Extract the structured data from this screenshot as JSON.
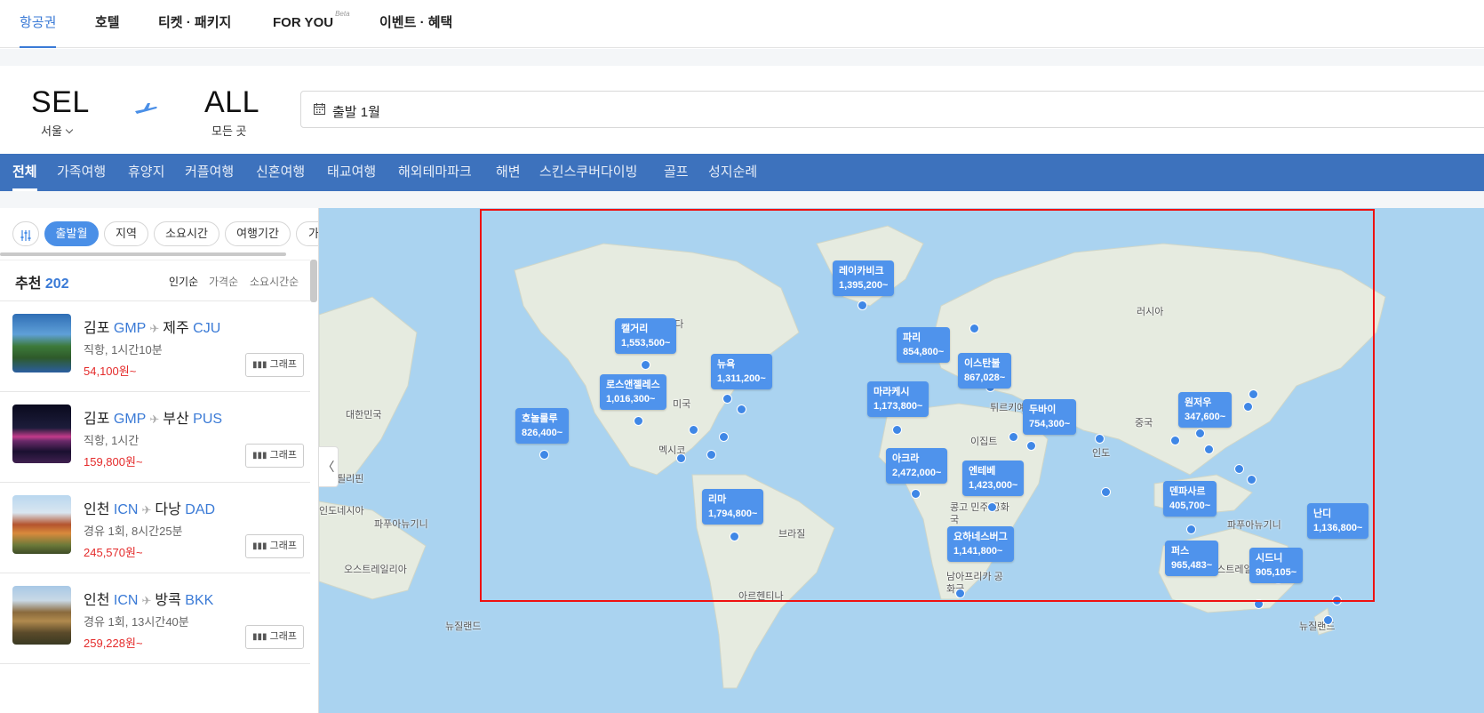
{
  "nav": {
    "tabs": [
      {
        "label": "항공권",
        "active": true
      },
      {
        "label": "호텔"
      },
      {
        "label": "티켓 · 패키지"
      },
      {
        "label": "FOR YOU",
        "badge": "Beta"
      },
      {
        "label": "이벤트 · 혜택"
      }
    ]
  },
  "search": {
    "origin_code": "SEL",
    "origin_city": "서울",
    "dest_code": "ALL",
    "dest_city": "모든 곳",
    "date_label": "출발 1월"
  },
  "themes": [
    "전체",
    "가족여행",
    "휴양지",
    "커플여행",
    "신혼여행",
    "태교여행",
    "해외테마파크",
    "해변",
    "스킨스쿠버다이빙",
    "골프",
    "성지순례"
  ],
  "filters": {
    "chips": [
      "출발월",
      "지역",
      "소요시간",
      "여행기간",
      "가"
    ],
    "active_chip": "출발월"
  },
  "recommend": {
    "title": "추천",
    "count": "202",
    "sorts": [
      "인기순",
      "가격순",
      "소요시간순"
    ],
    "active_sort": "인기순"
  },
  "items": [
    {
      "from": "김포",
      "from_code": "GMP",
      "to": "제주",
      "to_code": "CJU",
      "info": "직항, 1시간10분",
      "price": "54,100원~",
      "graph": "그래프"
    },
    {
      "from": "김포",
      "from_code": "GMP",
      "to": "부산",
      "to_code": "PUS",
      "info": "직항, 1시간",
      "price": "159,800원~",
      "graph": "그래프"
    },
    {
      "from": "인천",
      "from_code": "ICN",
      "to": "다낭",
      "to_code": "DAD",
      "info": "경유 1회, 8시간25분",
      "price": "245,570원~",
      "graph": "그래프"
    },
    {
      "from": "인천",
      "from_code": "ICN",
      "to": "방콕",
      "to_code": "BKK",
      "info": "경유 1회, 13시간40분",
      "price": "259,228원~",
      "graph": "그래프"
    }
  ],
  "map": {
    "price_tags": [
      {
        "city": "레이카비크",
        "price": "1,395,200~"
      },
      {
        "city": "캘거리",
        "price": "1,553,500~"
      },
      {
        "city": "뉴욕",
        "price": "1,311,200~"
      },
      {
        "city": "로스앤젤레스",
        "price": "1,016,300~"
      },
      {
        "city": "호놀룰루",
        "price": "826,400~"
      },
      {
        "city": "파리",
        "price": "854,800~"
      },
      {
        "city": "이스탄불",
        "price": "867,028~"
      },
      {
        "city": "마라케시",
        "price": "1,173,800~"
      },
      {
        "city": "두바이",
        "price": "754,300~"
      },
      {
        "city": "원저우",
        "price": "347,600~"
      },
      {
        "city": "아크라",
        "price": "2,472,000~"
      },
      {
        "city": "엔테베",
        "price": "1,423,000~"
      },
      {
        "city": "리마",
        "price": "1,794,800~"
      },
      {
        "city": "덴파사르",
        "price": "405,700~"
      },
      {
        "city": "난디",
        "price": "1,136,800~"
      },
      {
        "city": "요하네스버그",
        "price": "1,141,800~"
      },
      {
        "city": "퍼스",
        "price": "965,483~"
      },
      {
        "city": "시드니",
        "price": "905,105~"
      }
    ],
    "labels": [
      "러시아",
      "캐나다",
      "미국",
      "멕시코",
      "대한민국",
      "필리핀",
      "인도네시아",
      "파푸아뉴기니",
      "오스트레일리아",
      "뉴질랜드",
      "브라질",
      "아르헨티나",
      "이집트",
      "인도",
      "중국",
      "튀르키예",
      "콩고 민주 공화국",
      "남아프리카 공화국",
      "파푸아뉴기니",
      "오스트레일리아",
      "뉴질랜드"
    ],
    "collapse_glyph": "〈"
  }
}
